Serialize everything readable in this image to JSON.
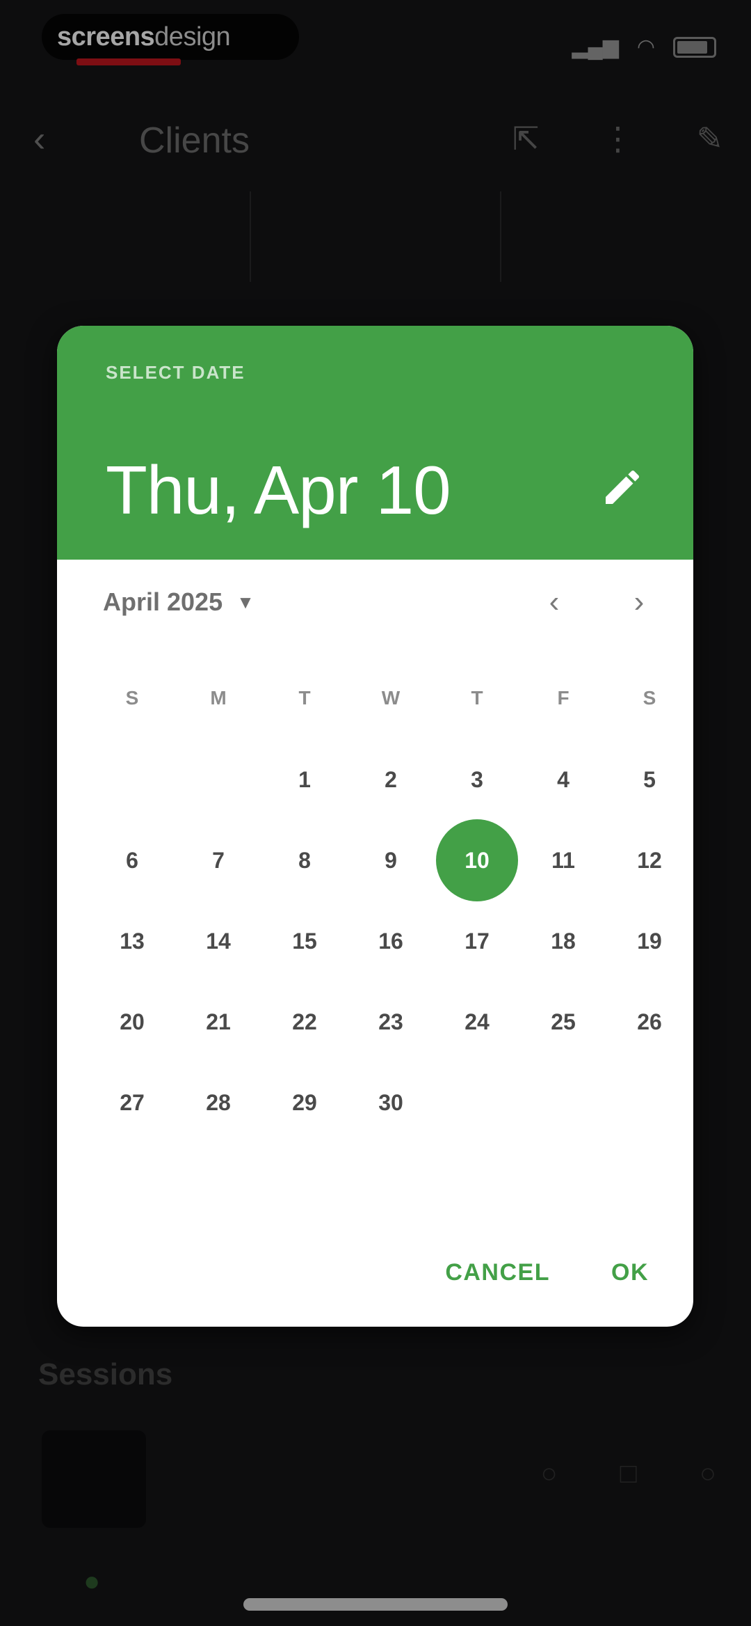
{
  "status_bar": {
    "brand_bold": "screens",
    "brand_light": "design"
  },
  "header": {
    "title": "Clients"
  },
  "stats": [
    {
      "value": "",
      "label": "",
      "color": "#c0161e"
    },
    {
      "value": "",
      "label": "",
      "color": "#6b6b2a"
    },
    {
      "value": "",
      "label": "",
      "color": "#b0181e"
    }
  ],
  "date_dialog": {
    "overline": "SELECT DATE",
    "selected_date": "Thu, Apr 10",
    "month_label": "April 2025",
    "weekdays": [
      "S",
      "M",
      "T",
      "W",
      "T",
      "F",
      "S"
    ],
    "weeks": [
      [
        "",
        "",
        "1",
        "2",
        "3",
        "4",
        "5"
      ],
      [
        "6",
        "7",
        "8",
        "9",
        "10",
        "11",
        "12"
      ],
      [
        "13",
        "14",
        "15",
        "16",
        "17",
        "18",
        "19"
      ],
      [
        "20",
        "21",
        "22",
        "23",
        "24",
        "25",
        "26"
      ],
      [
        "27",
        "28",
        "29",
        "30",
        "",
        "",
        ""
      ]
    ],
    "selected_day": "10",
    "cancel_label": "CANCEL",
    "ok_label": "OK",
    "accent_color": "#43a047"
  },
  "section": {
    "title": "Sessions",
    "link": ""
  },
  "list": {
    "item_name": ""
  },
  "note": {
    "text": ""
  }
}
